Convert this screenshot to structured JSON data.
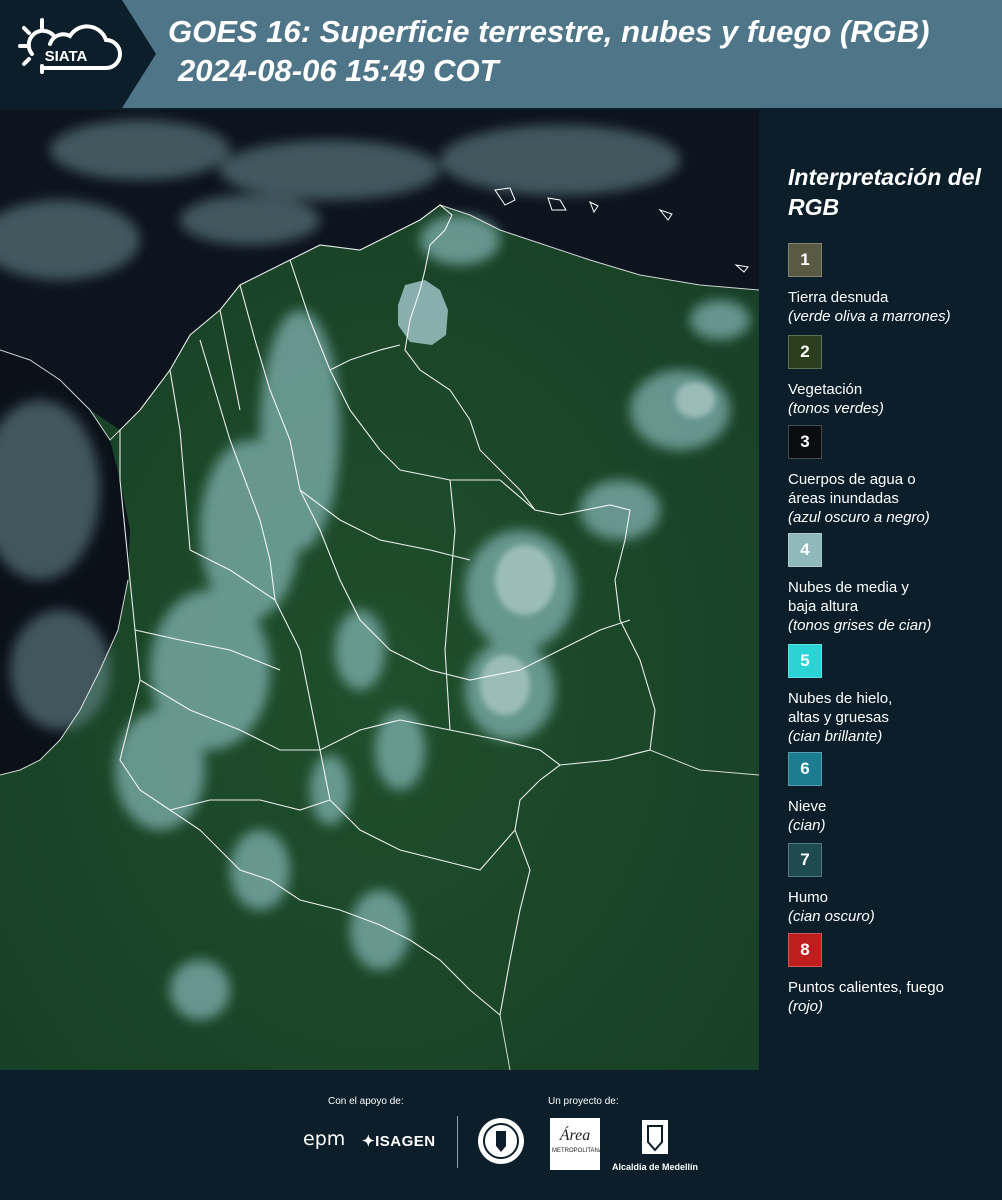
{
  "header": {
    "logo_text": "SIATA",
    "title_line1": "GOES 16: Superficie terrestre, nubes y fuego (RGB)",
    "title_line2": "2024-08-06 15:49 COT"
  },
  "legend": {
    "title": "Interpretación del RGB",
    "items": [
      {
        "number": "1",
        "label": "Tierra desnuda",
        "note": "(verde oliva a marrones)",
        "color": "#5a5a42"
      },
      {
        "number": "2",
        "label": "Vegetación",
        "note": "(tonos verdes)",
        "color": "#2b3f1e"
      },
      {
        "number": "3",
        "label": "Cuerpos de agua o\náreas inundadas",
        "note": "(azul oscuro a negro)",
        "color": "#0a0d10"
      },
      {
        "number": "4",
        "label": "Nubes de media y\nbaja altura",
        "note": "(tonos grises de cian)",
        "color": "#8fb9bb"
      },
      {
        "number": "5",
        "label": "Nubes de hielo,\naltas y gruesas",
        "note": "(cian brillante)",
        "color": "#2ad4d6"
      },
      {
        "number": "6",
        "label": "Nieve",
        "note": "(cian)",
        "color": "#1c7d91"
      },
      {
        "number": "7",
        "label": "Humo",
        "note": "(cian oscuro)",
        "color": "#1d4b50"
      },
      {
        "number": "8",
        "label": "Puntos calientes, fuego",
        "note": "(rojo)",
        "color": "#bf1e1e"
      }
    ]
  },
  "footer": {
    "support_title": "Con el apoyo de:",
    "project_title": "Un proyecto de:",
    "sponsors": [
      "epm",
      "ISAGEN"
    ],
    "partners": [
      "METROPOLITANA",
      "Alcaldía de Medellín"
    ]
  },
  "map": {
    "colors": {
      "land": "#1d4a2a",
      "ocean": "#0a1018",
      "cloud": "#8fbdc0",
      "border": "#ffffff"
    }
  }
}
